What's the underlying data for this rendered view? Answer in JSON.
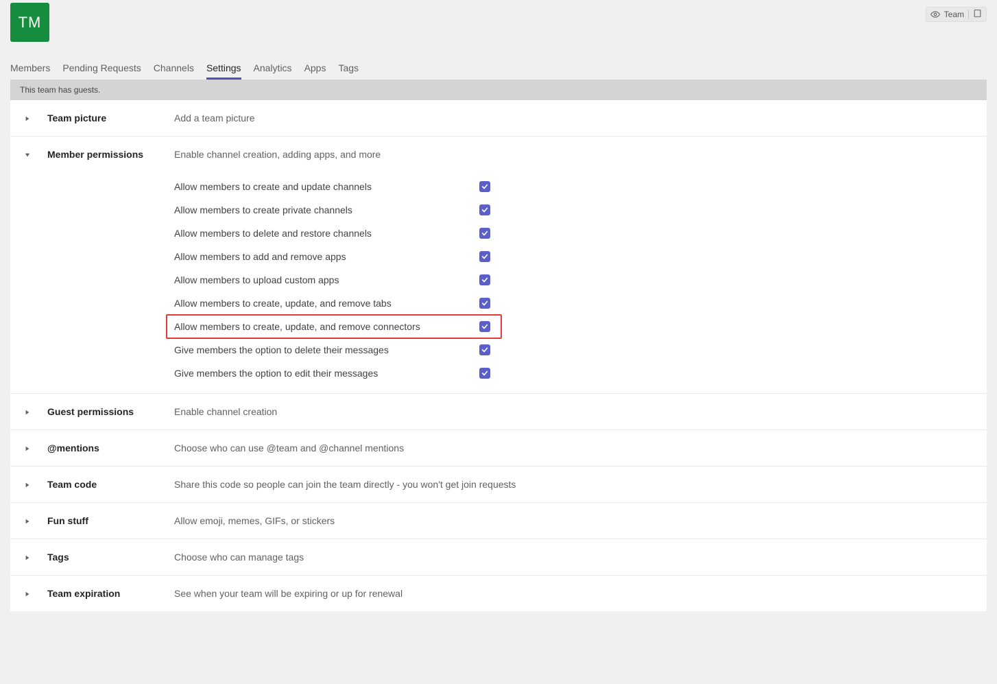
{
  "team": {
    "avatar_initials": "TM",
    "visibility_label": "Team"
  },
  "tabs": {
    "members": "Members",
    "pending_requests": "Pending Requests",
    "channels": "Channels",
    "settings": "Settings",
    "analytics": "Analytics",
    "apps": "Apps",
    "tags": "Tags",
    "active": "settings"
  },
  "banner": {
    "guests_notice": "This team has guests."
  },
  "sections": {
    "team_picture": {
      "title": "Team picture",
      "desc": "Add a team picture",
      "expanded": false
    },
    "member_permissions": {
      "title": "Member permissions",
      "desc": "Enable channel creation, adding apps, and more",
      "expanded": true,
      "items": [
        {
          "label": "Allow members to create and update channels",
          "checked": true
        },
        {
          "label": "Allow members to create private channels",
          "checked": true
        },
        {
          "label": "Allow members to delete and restore channels",
          "checked": true
        },
        {
          "label": "Allow members to add and remove apps",
          "checked": true
        },
        {
          "label": "Allow members to upload custom apps",
          "checked": true
        },
        {
          "label": "Allow members to create, update, and remove tabs",
          "checked": true
        },
        {
          "label": "Allow members to create, update, and remove connectors",
          "checked": true,
          "highlight": true
        },
        {
          "label": "Give members the option to delete their messages",
          "checked": true
        },
        {
          "label": "Give members the option to edit their messages",
          "checked": true
        }
      ]
    },
    "guest_permissions": {
      "title": "Guest permissions",
      "desc": "Enable channel creation",
      "expanded": false
    },
    "mentions": {
      "title": "@mentions",
      "desc": "Choose who can use @team and @channel mentions",
      "expanded": false
    },
    "team_code": {
      "title": "Team code",
      "desc": "Share this code so people can join the team directly - you won't get join requests",
      "expanded": false
    },
    "fun_stuff": {
      "title": "Fun stuff",
      "desc": "Allow emoji, memes, GIFs, or stickers",
      "expanded": false
    },
    "tags": {
      "title": "Tags",
      "desc": "Choose who can manage tags",
      "expanded": false
    },
    "team_expiration": {
      "title": "Team expiration",
      "desc": "See when your team will be expiring or up for renewal",
      "expanded": false
    }
  }
}
